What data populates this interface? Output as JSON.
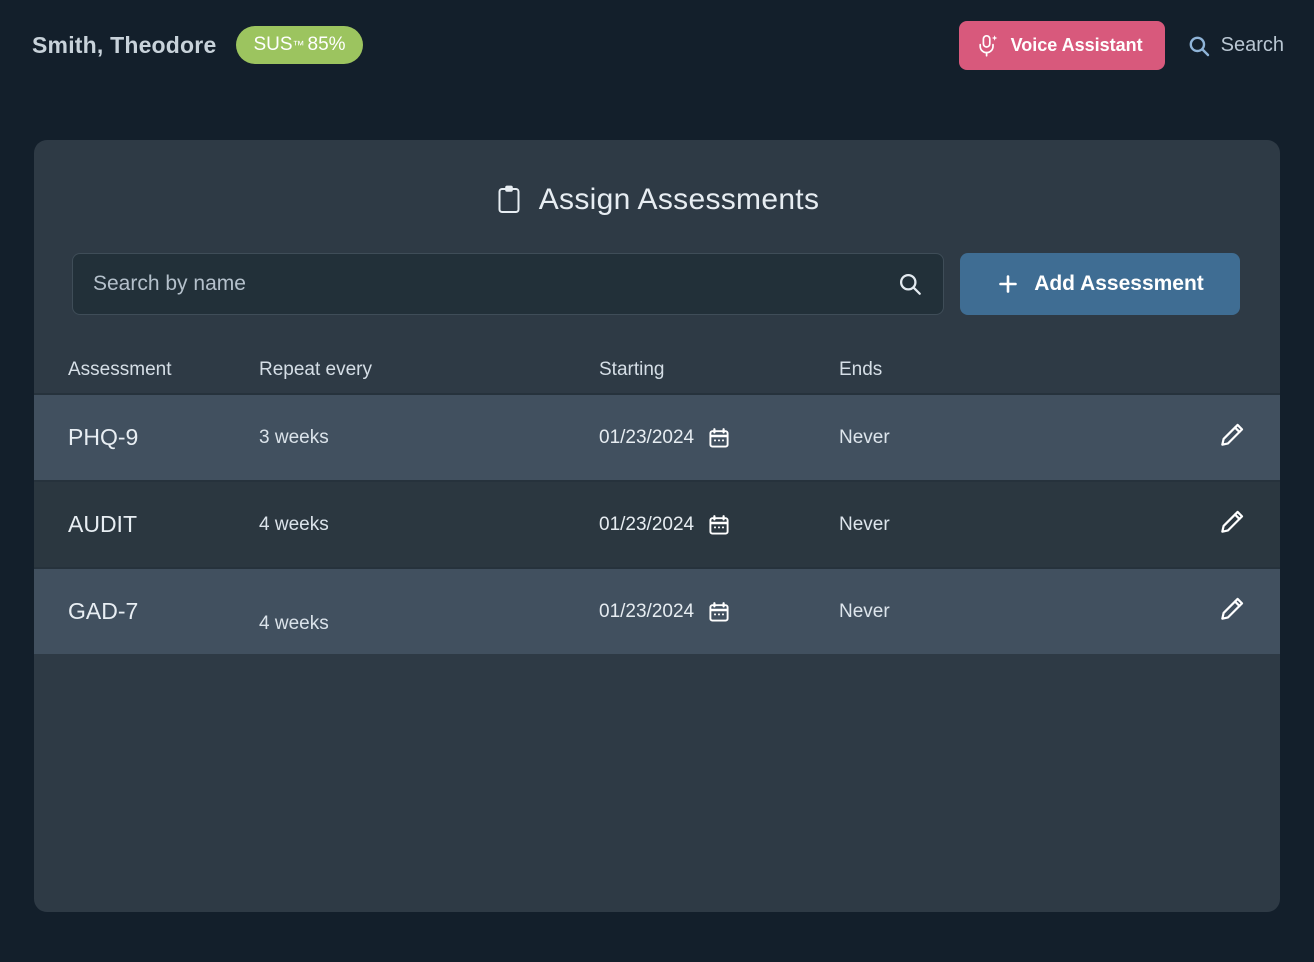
{
  "header": {
    "patient_name": "Smith, Theodore",
    "sus_badge": {
      "label": "SUS",
      "tm": "™",
      "score": "85%"
    },
    "voice_assistant_label": "Voice Assistant",
    "search_label": "Search",
    "voice_icon": "microphone-sparkle-icon",
    "search_icon": "search-icon",
    "accent_pink": "#d8597c",
    "badge_green": "#9cc45f"
  },
  "card": {
    "title": "Assign Assessments",
    "title_icon": "clipboard-icon",
    "search": {
      "placeholder": "Search by name",
      "value": "",
      "icon": "search-icon"
    },
    "add_button": {
      "label": "Add Assessment",
      "icon": "plus-icon",
      "color": "#3f6d93"
    },
    "table": {
      "columns": [
        "Assessment",
        "Repeat every",
        "Starting",
        "Ends"
      ],
      "rows": [
        {
          "assessment": "PHQ-9",
          "repeat": "3 weeks",
          "starting": "01/23/2024",
          "ends": "Never",
          "calendar_icon": "calendar-icon",
          "edit_icon": "pencil-icon"
        },
        {
          "assessment": "AUDIT",
          "repeat": "4 weeks",
          "starting": "01/23/2024",
          "ends": "Never",
          "calendar_icon": "calendar-icon",
          "edit_icon": "pencil-icon"
        },
        {
          "assessment": "GAD-7",
          "repeat": "4 weeks",
          "starting": "01/23/2024",
          "ends": "Never",
          "calendar_icon": "calendar-icon",
          "edit_icon": "pencil-icon"
        }
      ]
    }
  }
}
